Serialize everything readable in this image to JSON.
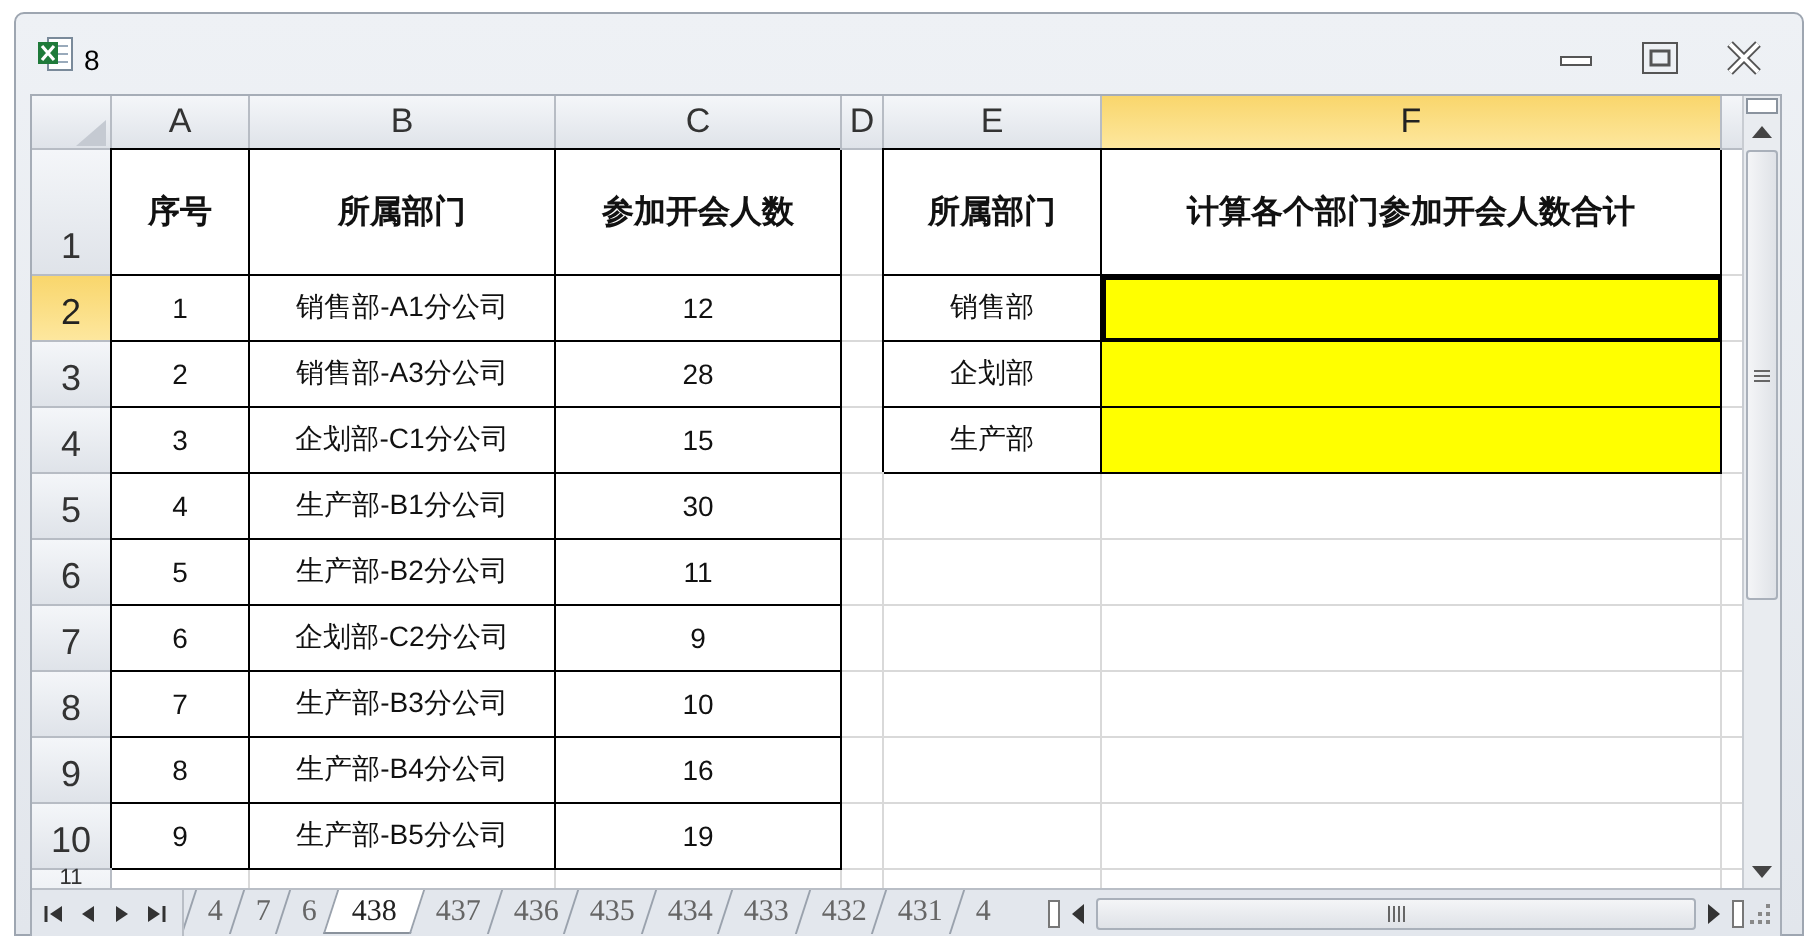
{
  "window": {
    "title": "8"
  },
  "columns": [
    {
      "label": "A",
      "selected": false
    },
    {
      "label": "B",
      "selected": false
    },
    {
      "label": "C",
      "selected": false
    },
    {
      "label": "D",
      "selected": false
    },
    {
      "label": "E",
      "selected": false
    },
    {
      "label": "F",
      "selected": true
    }
  ],
  "rows": [
    {
      "header": "1",
      "selected": false,
      "kind": "header",
      "cells": [
        {
          "text": "序号",
          "bordered": true,
          "selected": false
        },
        {
          "text": "所属部门",
          "bordered": true,
          "selected": false
        },
        {
          "text": "参加开会人数",
          "bordered": true,
          "selected": false
        },
        {
          "selected": false
        },
        {
          "text": "所属部门",
          "bordered": true,
          "selected": false
        },
        {
          "text": "计算各个部门参加开会人数合计",
          "bordered": true,
          "selected": false
        }
      ]
    },
    {
      "header": "2",
      "selected": true,
      "kind": "data",
      "cells": [
        {
          "text": "1",
          "bordered": true,
          "selected": false
        },
        {
          "text": "销售部-A1分公司",
          "bordered": true,
          "selected": false
        },
        {
          "text": "12",
          "bordered": true,
          "selected": false
        },
        {
          "selected": false
        },
        {
          "text": "销售部",
          "bordered": true,
          "selected": false
        },
        {
          "bordered": true,
          "color": "#ffff00",
          "selected": true
        }
      ]
    },
    {
      "header": "3",
      "selected": false,
      "kind": "data",
      "cells": [
        {
          "text": "2",
          "bordered": true,
          "selected": false
        },
        {
          "text": "销售部-A3分公司",
          "bordered": true,
          "selected": false
        },
        {
          "text": "28",
          "bordered": true,
          "selected": false
        },
        {
          "selected": false
        },
        {
          "text": "企划部",
          "bordered": true,
          "selected": false
        },
        {
          "bordered": true,
          "color": "#ffff00",
          "selected": false
        }
      ]
    },
    {
      "header": "4",
      "selected": false,
      "kind": "data",
      "cells": [
        {
          "text": "3",
          "bordered": true,
          "selected": false
        },
        {
          "text": "企划部-C1分公司",
          "bordered": true,
          "selected": false
        },
        {
          "text": "15",
          "bordered": true,
          "selected": false
        },
        {
          "selected": false
        },
        {
          "text": "生产部",
          "bordered": true,
          "selected": false
        },
        {
          "bordered": true,
          "color": "#ffff00",
          "selected": false
        }
      ]
    },
    {
      "header": "5",
      "selected": false,
      "kind": "data",
      "cells": [
        {
          "text": "4",
          "bordered": true,
          "selected": false
        },
        {
          "text": "生产部-B1分公司",
          "bordered": true,
          "selected": false
        },
        {
          "text": "30",
          "bordered": true,
          "selected": false
        },
        {
          "selected": false
        },
        {
          "selected": false
        },
        {
          "selected": false
        }
      ]
    },
    {
      "header": "6",
      "selected": false,
      "kind": "data",
      "cells": [
        {
          "text": "5",
          "bordered": true,
          "selected": false
        },
        {
          "text": "生产部-B2分公司",
          "bordered": true,
          "selected": false
        },
        {
          "text": "11",
          "bordered": true,
          "selected": false
        },
        {
          "selected": false
        },
        {
          "selected": false
        },
        {
          "selected": false
        }
      ]
    },
    {
      "header": "7",
      "selected": false,
      "kind": "data",
      "cells": [
        {
          "text": "6",
          "bordered": true,
          "selected": false
        },
        {
          "text": "企划部-C2分公司",
          "bordered": true,
          "selected": false
        },
        {
          "text": "9",
          "bordered": true,
          "selected": false
        },
        {
          "selected": false
        },
        {
          "selected": false
        },
        {
          "selected": false
        }
      ]
    },
    {
      "header": "8",
      "selected": false,
      "kind": "data",
      "cells": [
        {
          "text": "7",
          "bordered": true,
          "selected": false
        },
        {
          "text": "生产部-B3分公司",
          "bordered": true,
          "selected": false
        },
        {
          "text": "10",
          "bordered": true,
          "selected": false
        },
        {
          "selected": false
        },
        {
          "selected": false
        },
        {
          "selected": false
        }
      ]
    },
    {
      "header": "9",
      "selected": false,
      "kind": "data",
      "cells": [
        {
          "text": "8",
          "bordered": true,
          "selected": false
        },
        {
          "text": "生产部-B4分公司",
          "bordered": true,
          "selected": false
        },
        {
          "text": "16",
          "bordered": true,
          "selected": false
        },
        {
          "selected": false
        },
        {
          "selected": false
        },
        {
          "selected": false
        }
      ]
    },
    {
      "header": "10",
      "selected": false,
      "kind": "data",
      "cells": [
        {
          "text": "9",
          "bordered": true,
          "selected": false
        },
        {
          "text": "生产部-B5分公司",
          "bordered": true,
          "selected": false
        },
        {
          "text": "19",
          "bordered": true,
          "selected": false
        },
        {
          "selected": false
        },
        {
          "selected": false
        },
        {
          "selected": false
        }
      ]
    },
    {
      "header": "11",
      "selected": false,
      "kind": "data",
      "cells": [
        {
          "selected": false
        },
        {
          "selected": false
        },
        {
          "selected": false
        },
        {
          "selected": false
        },
        {
          "selected": false
        },
        {
          "selected": false
        }
      ]
    }
  ],
  "sheet_tabs": [
    {
      "label": "4",
      "selected": false
    },
    {
      "label": "7",
      "selected": false
    },
    {
      "label": "6",
      "selected": false
    },
    {
      "label": "438",
      "selected": true
    },
    {
      "label": "437",
      "selected": false
    },
    {
      "label": "436",
      "selected": false
    },
    {
      "label": "435",
      "selected": false
    },
    {
      "label": "434",
      "selected": false
    },
    {
      "label": "433",
      "selected": false
    },
    {
      "label": "432",
      "selected": false
    },
    {
      "label": "431",
      "selected": false
    },
    {
      "label": "4",
      "selected": false
    }
  ]
}
